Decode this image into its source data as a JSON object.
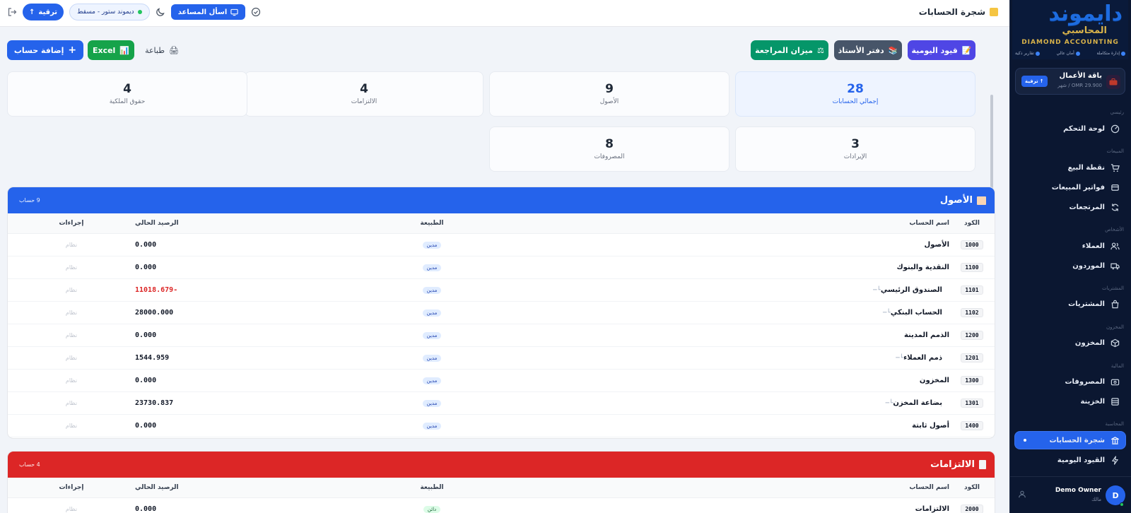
{
  "sidebar": {
    "logo": {
      "arabic": "دايموند",
      "subtitle": "المحاسبي",
      "english": "DIAMOND ACCOUNTING",
      "tags": [
        "إدارة متكاملة",
        "أمان عالي",
        "تقارير ذكية"
      ]
    },
    "plan": {
      "name": "باقة الأعمال",
      "price": "OMR 29.900 / شهر",
      "upgrade": "ترقية"
    },
    "sections": {
      "main": "رئيسي",
      "sales": "المبيعات",
      "people": "الأشخاص",
      "purchases": "المشتريات",
      "inventory": "المخزون",
      "finance": "المالية",
      "accounting": "المحاسبة"
    },
    "items": {
      "dashboard": "لوحة التحكم",
      "pos": "نقطة البيع",
      "sales_invoices": "فواتير المبيعات",
      "returns": "المرتجعات",
      "customers": "العملاء",
      "suppliers": "الموردون",
      "purchases": "المشتريات",
      "inventory": "المخزون",
      "expenses": "المصروفات",
      "treasury": "الخزينة",
      "chart_of_accounts": "شجرة الحسابات",
      "journal": "القيود اليومية"
    },
    "user": {
      "initial": "D",
      "name": "Demo Owner",
      "role": "مالك"
    }
  },
  "topbar": {
    "title": "شجرة الحسابات",
    "ask": "اسأل المساعد",
    "store": "ديموند ستور - مسقط",
    "upgrade": "ترقية"
  },
  "actions": {
    "journal": "قيود اليومية",
    "ledger": "دفتر الأستاذ",
    "trial": "ميزان المراجعة",
    "add": "إضافة حساب",
    "excel": "Excel",
    "print": "طباعة"
  },
  "stats": {
    "total": {
      "value": "28",
      "label": "إجمالي الحسابات"
    },
    "assets": {
      "value": "9",
      "label": "الأصول"
    },
    "liabilities": {
      "value": "4",
      "label": "الالتزامات"
    },
    "equity": {
      "value": "4",
      "label": "حقوق الملكية"
    },
    "revenue": {
      "value": "3",
      "label": "الإيرادات"
    },
    "expenses": {
      "value": "8",
      "label": "المصروفات"
    }
  },
  "columns": {
    "code": "الكود",
    "name": "اسم الحساب",
    "type": "الطبيعة",
    "balance": "الرصيد الحالي",
    "actions": "إجراءات"
  },
  "assets": {
    "title": "الأصول",
    "count": "9 حساب",
    "rows": [
      {
        "code": "1000",
        "name": "الأصول",
        "type": "مدين",
        "balance": "0.000",
        "action": "نظام"
      },
      {
        "code": "1100",
        "name": "النقدية والبنوك",
        "type": "مدين",
        "balance": "0.000",
        "action": "نظام"
      },
      {
        "code": "1101",
        "name": "الصندوق الرئيسي",
        "type": "مدين",
        "balance": "-11018.679",
        "action": "نظام"
      },
      {
        "code": "1102",
        "name": "الحساب البنكي",
        "type": "مدين",
        "balance": "28000.000",
        "action": "نظام"
      },
      {
        "code": "1200",
        "name": "الذمم المدينة",
        "type": "مدين",
        "balance": "0.000",
        "action": "نظام"
      },
      {
        "code": "1201",
        "name": "ذمم العملاء",
        "type": "مدين",
        "balance": "1544.959",
        "action": "نظام"
      },
      {
        "code": "1300",
        "name": "المخزون",
        "type": "مدين",
        "balance": "0.000",
        "action": "نظام"
      },
      {
        "code": "1301",
        "name": "بضاعة المخزن",
        "type": "مدين",
        "balance": "23730.837",
        "action": "نظام"
      },
      {
        "code": "1400",
        "name": "أصول ثابتة",
        "type": "مدين",
        "balance": "0.000",
        "action": "نظام"
      }
    ]
  },
  "liabilities": {
    "title": "الالتزامات",
    "count": "4 حساب",
    "rows": [
      {
        "code": "2000",
        "name": "الالتزامات",
        "type": "دائن",
        "balance": "0.000",
        "action": "نظام"
      }
    ]
  }
}
